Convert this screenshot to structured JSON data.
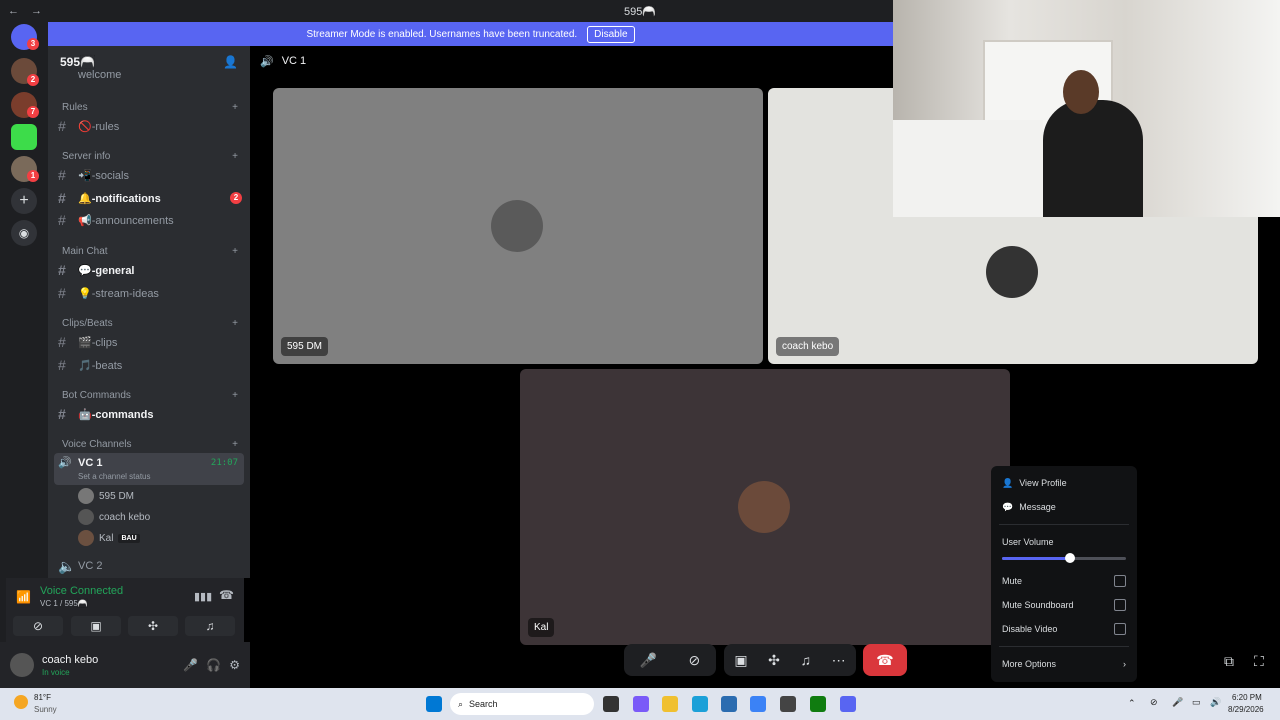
{
  "window": {
    "title": "595🦳"
  },
  "banner": {
    "text": "Streamer Mode is enabled. Usernames have been truncated.",
    "button": "Disable"
  },
  "server": {
    "name": "595🦳",
    "rail_badges": [
      "3",
      "2",
      "7",
      "1"
    ]
  },
  "categories": [
    {
      "name": "Rules"
    },
    {
      "name": "Server info"
    },
    {
      "name": "Main Chat"
    },
    {
      "name": "Clips/Beats"
    },
    {
      "name": "Bot Commands"
    },
    {
      "name": "Voice Channels"
    }
  ],
  "channels": {
    "welcome": "welcome",
    "rules": "🚫-rules",
    "socials": "📲-socials",
    "notifications": "🔔-notifications",
    "notifications_badge": "2",
    "announcements": "📢-announcements",
    "general": "💬-general",
    "stream_ideas": "💡-stream-ideas",
    "clips": "🎬-clips",
    "beats": "🎵-beats",
    "commands": "🤖-commands"
  },
  "voice": {
    "vc1": "VC 1",
    "vc1_time": "21:07",
    "vc1_status": "Set a channel status",
    "members": [
      "595 DM",
      "coach kebo",
      "Kal"
    ],
    "kal_tag": "BAU",
    "vc2": "VC 2"
  },
  "voice_panel": {
    "status": "Voice Connected",
    "channel": "VC 1 / 595🦳"
  },
  "user": {
    "name": "coach kebo",
    "status": "In voice"
  },
  "main": {
    "channel": "VC 1"
  },
  "tiles": [
    {
      "name": "595 DM",
      "color": "#808080"
    },
    {
      "name": "coach kebo",
      "color": "#e3e3df"
    },
    {
      "name": "Kal",
      "color": "#3d3437"
    }
  ],
  "menu": {
    "view_profile": "View Profile",
    "message": "Message",
    "user_volume": "User Volume",
    "volume_level": 0.55,
    "mute": "Mute",
    "mute_soundboard": "Mute Soundboard",
    "disable_video": "Disable Video",
    "more_options": "More Options"
  },
  "taskbar": {
    "weather_temp": "81°F",
    "weather_desc": "Sunny",
    "search": "Search",
    "time": "6:20 PM",
    "date": "8/29/2026"
  },
  "colors": {
    "accent": "#5865f2",
    "danger": "#da373c",
    "online": "#23a55a"
  }
}
